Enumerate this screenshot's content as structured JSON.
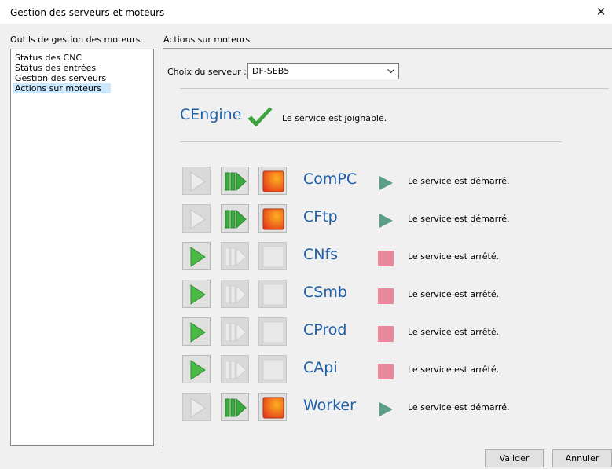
{
  "window": {
    "title": "Gestion des serveurs et moteurs",
    "close_label": "✕"
  },
  "left": {
    "header": "Outils de gestion des moteurs",
    "items": [
      {
        "label": "Status des CNC",
        "selected": false
      },
      {
        "label": "Status des entrées",
        "selected": false
      },
      {
        "label": "Gestion des serveurs",
        "selected": false
      },
      {
        "label": "Actions sur moteurs",
        "selected": true
      }
    ]
  },
  "right": {
    "header": "Actions sur moteurs",
    "server_label": "Choix du serveur :",
    "server_value": "DF-SEB5"
  },
  "engine": {
    "name": "CEngine",
    "status": "Le service est joignable.",
    "check_color": "#3aa83a"
  },
  "services": [
    {
      "name": "ComPC",
      "state": "running",
      "status": "Le service est démarré."
    },
    {
      "name": "CFtp",
      "state": "running",
      "status": "Le service est démarré."
    },
    {
      "name": "CNfs",
      "state": "stopped",
      "status": "Le service est arrêté."
    },
    {
      "name": "CSmb",
      "state": "stopped",
      "status": "Le service est arrêté."
    },
    {
      "name": "CProd",
      "state": "stopped",
      "status": "Le service est arrêté."
    },
    {
      "name": "CApi",
      "state": "stopped",
      "status": "Le service est arrêté."
    },
    {
      "name": "Worker",
      "state": "running",
      "status": "Le service est démarré."
    }
  ],
  "colors": {
    "service_name": "#1e5fa8",
    "running_icon": "#5b9e8a",
    "stopped_icon": "#e8889a",
    "play_green": "#4cb848",
    "stop_red": "#e94a1f"
  },
  "buttons": {
    "ok": "Valider",
    "cancel": "Annuler"
  }
}
